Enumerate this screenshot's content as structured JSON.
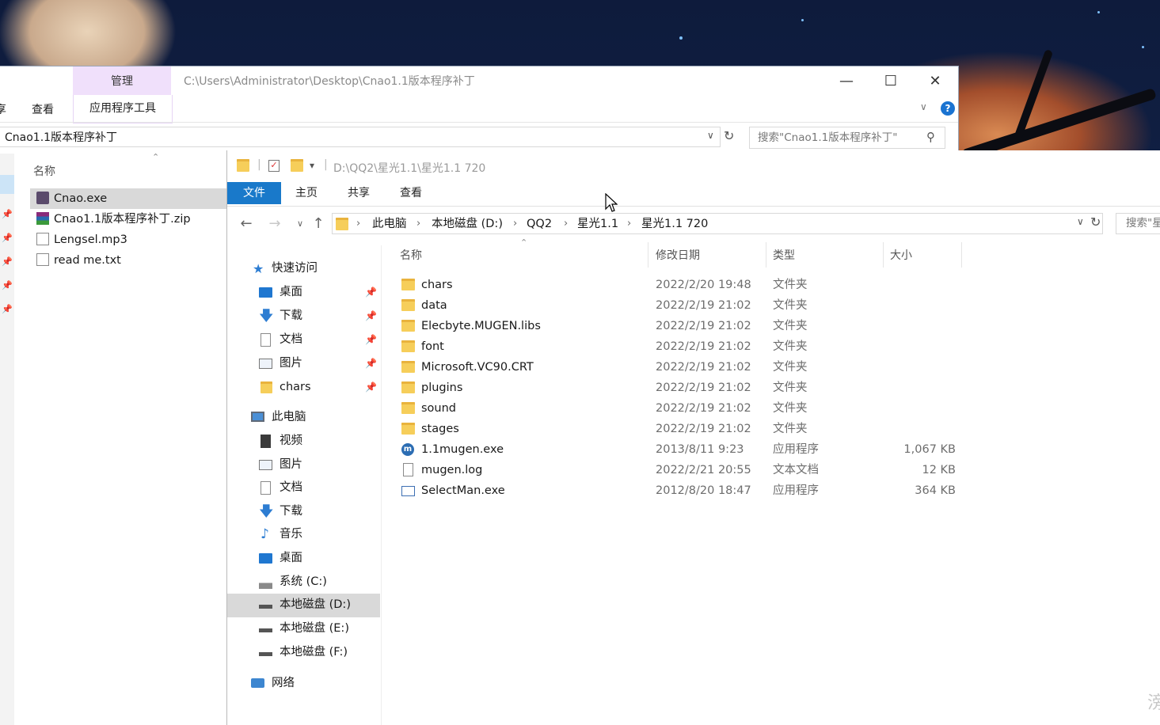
{
  "back_window": {
    "manage_tab": "管理",
    "app_tools_tab": "应用程序工具",
    "title_path": "C:\\Users\\Administrator\\Desktop\\Cnao1.1版本程序补丁",
    "edge_tab": "享",
    "view_tab": "查看",
    "address": "Cnao1.1版本程序补丁",
    "search_placeholder": "搜索\"Cnao1.1版本程序补丁\"",
    "column_name": "名称",
    "files": [
      "Cnao.exe",
      "Cnao1.1版本程序补丁.zip",
      "Lengsel.mp3",
      "read me.txt"
    ]
  },
  "front_window": {
    "title_path": "D:\\QQ2\\星光1.1\\星光1.1 720",
    "tabs": {
      "file": "文件",
      "home": "主页",
      "share": "共享",
      "view": "查看"
    },
    "breadcrumb": [
      "此电脑",
      "本地磁盘 (D:)",
      "QQ2",
      "星光1.1",
      "星光1.1 720"
    ],
    "search_placeholder": "搜索\"星",
    "nav": {
      "quick_access": "快速访问",
      "desktop": "桌面",
      "downloads": "下载",
      "documents": "文档",
      "pictures": "图片",
      "chars": "chars",
      "this_pc": "此电脑",
      "videos": "视频",
      "pictures2": "图片",
      "documents2": "文档",
      "downloads2": "下载",
      "music": "音乐",
      "desktop2": "桌面",
      "drive_c": "系统 (C:)",
      "drive_d": "本地磁盘 (D:)",
      "drive_e": "本地磁盘 (E:)",
      "drive_f": "本地磁盘 (F:)",
      "network": "网络"
    },
    "columns": {
      "name": "名称",
      "date": "修改日期",
      "type": "类型",
      "size": "大小"
    },
    "rows": [
      {
        "name": "chars",
        "date": "2022/2/20 19:48",
        "type": "文件夹",
        "size": ""
      },
      {
        "name": "data",
        "date": "2022/2/19 21:02",
        "type": "文件夹",
        "size": ""
      },
      {
        "name": "Elecbyte.MUGEN.libs",
        "date": "2022/2/19 21:02",
        "type": "文件夹",
        "size": ""
      },
      {
        "name": "font",
        "date": "2022/2/19 21:02",
        "type": "文件夹",
        "size": ""
      },
      {
        "name": "Microsoft.VC90.CRT",
        "date": "2022/2/19 21:02",
        "type": "文件夹",
        "size": ""
      },
      {
        "name": "plugins",
        "date": "2022/2/19 21:02",
        "type": "文件夹",
        "size": ""
      },
      {
        "name": "sound",
        "date": "2022/2/19 21:02",
        "type": "文件夹",
        "size": ""
      },
      {
        "name": "stages",
        "date": "2022/2/19 21:02",
        "type": "文件夹",
        "size": ""
      },
      {
        "name": "1.1mugen.exe",
        "date": "2013/8/11 9:23",
        "type": "应用程序",
        "size": "1,067 KB"
      },
      {
        "name": "mugen.log",
        "date": "2022/2/21 20:55",
        "type": "文本文档",
        "size": "12 KB"
      },
      {
        "name": "SelectMan.exe",
        "date": "2012/8/20 18:47",
        "type": "应用程序",
        "size": "364 KB"
      }
    ]
  },
  "watermark": "滂"
}
